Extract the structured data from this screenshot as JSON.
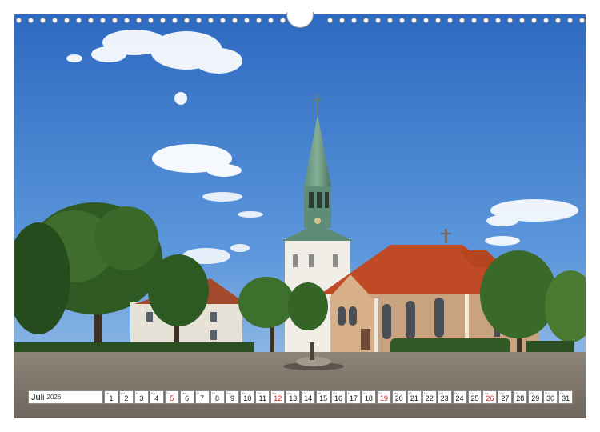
{
  "calendar": {
    "month": "Juli",
    "year": "2026",
    "days": [
      {
        "wd": "Mi",
        "d": "1",
        "sunday": false
      },
      {
        "wd": "Do",
        "d": "2",
        "sunday": false
      },
      {
        "wd": "Fr",
        "d": "3",
        "sunday": false
      },
      {
        "wd": "Sa",
        "d": "4",
        "sunday": false
      },
      {
        "wd": "So",
        "d": "5",
        "sunday": true
      },
      {
        "wd": "Mo",
        "d": "6",
        "sunday": false
      },
      {
        "wd": "Di",
        "d": "7",
        "sunday": false
      },
      {
        "wd": "Mi",
        "d": "8",
        "sunday": false
      },
      {
        "wd": "Do",
        "d": "9",
        "sunday": false
      },
      {
        "wd": "Fr",
        "d": "10",
        "sunday": false
      },
      {
        "wd": "Sa",
        "d": "11",
        "sunday": false
      },
      {
        "wd": "So",
        "d": "12",
        "sunday": true
      },
      {
        "wd": "Mo",
        "d": "13",
        "sunday": false
      },
      {
        "wd": "Di",
        "d": "14",
        "sunday": false
      },
      {
        "wd": "Mi",
        "d": "15",
        "sunday": false
      },
      {
        "wd": "Do",
        "d": "16",
        "sunday": false
      },
      {
        "wd": "Fr",
        "d": "17",
        "sunday": false
      },
      {
        "wd": "Sa",
        "d": "18",
        "sunday": false
      },
      {
        "wd": "So",
        "d": "19",
        "sunday": true
      },
      {
        "wd": "Mo",
        "d": "20",
        "sunday": false
      },
      {
        "wd": "Di",
        "d": "21",
        "sunday": false
      },
      {
        "wd": "Mi",
        "d": "22",
        "sunday": false
      },
      {
        "wd": "Do",
        "d": "23",
        "sunday": false
      },
      {
        "wd": "Fr",
        "d": "24",
        "sunday": false
      },
      {
        "wd": "Sa",
        "d": "25",
        "sunday": false
      },
      {
        "wd": "So",
        "d": "26",
        "sunday": true
      },
      {
        "wd": "Mo",
        "d": "27",
        "sunday": false
      },
      {
        "wd": "Di",
        "d": "28",
        "sunday": false
      },
      {
        "wd": "Mi",
        "d": "29",
        "sunday": false
      },
      {
        "wd": "Do",
        "d": "30",
        "sunday": false
      },
      {
        "wd": "Fr",
        "d": "31",
        "sunday": false
      }
    ]
  },
  "colors": {
    "sunday": "#d41a1a",
    "sky_top": "#2f6fc4",
    "sky_bottom": "#8fbde8"
  },
  "photo": {
    "subject": "church-with-green-spire",
    "icons": [
      "church-icon",
      "cloud-icon",
      "tree-icon",
      "fountain-icon"
    ]
  }
}
